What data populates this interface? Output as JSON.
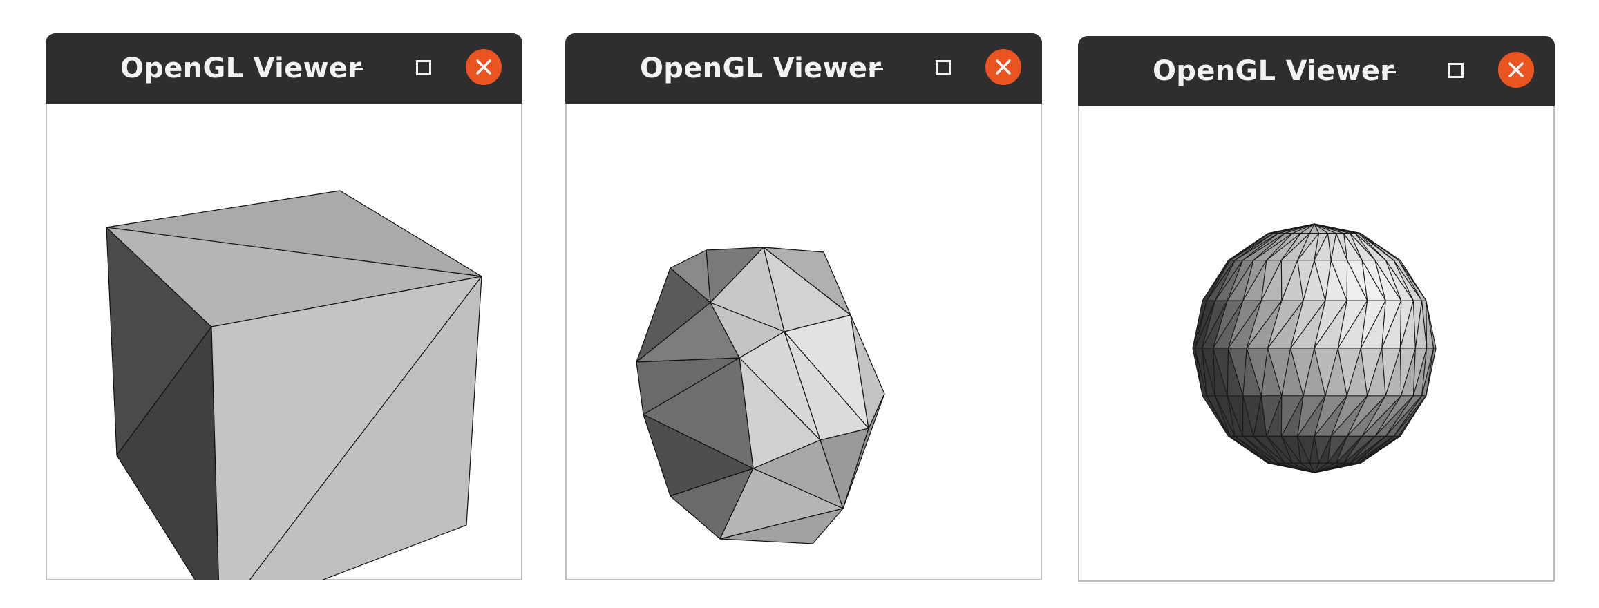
{
  "windows": [
    {
      "title": "OpenGL Viewer",
      "model": "cube"
    },
    {
      "title": "OpenGL Viewer",
      "model": "icosahedron"
    },
    {
      "title": "OpenGL Viewer",
      "model": "subdivided-icosphere"
    }
  ],
  "colors": {
    "titlebar": "#2e2e2e",
    "title_text": "#f2f2f2",
    "close_button": "#e95420",
    "window_border": "#bdbdbd",
    "background": "#ffffff"
  },
  "icons": {
    "minimize": "minimize-icon",
    "maximize": "maximize-icon",
    "close": "close-icon"
  }
}
